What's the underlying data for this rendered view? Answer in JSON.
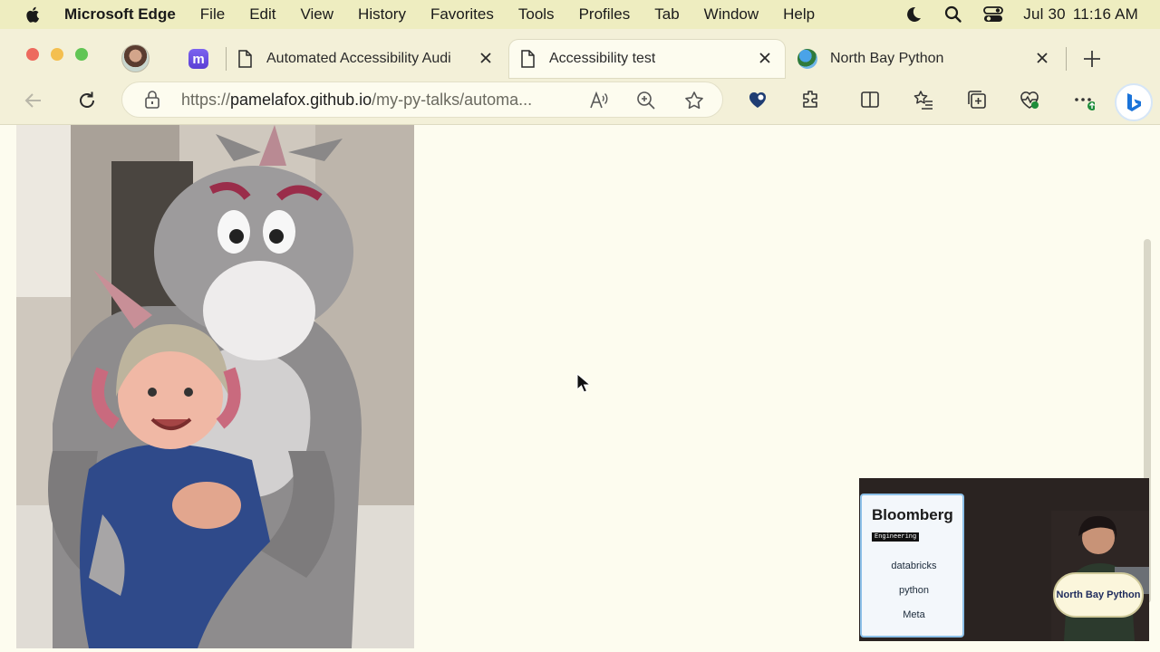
{
  "menubar": {
    "app_name": "Microsoft Edge",
    "items": [
      "File",
      "Edit",
      "View",
      "History",
      "Favorites",
      "Tools",
      "Profiles",
      "Tab",
      "Window",
      "Help"
    ],
    "date": "Jul 30",
    "time": "11:16 AM"
  },
  "tabs": [
    {
      "title": "Automated Accessibility Audi",
      "icon": "document-icon",
      "active": false
    },
    {
      "title": "Accessibility test",
      "icon": "document-icon",
      "active": true
    },
    {
      "title": "North Bay Python",
      "icon": "globe-icon",
      "active": false
    }
  ],
  "address_bar": {
    "url_prefix": "https://",
    "url_host": "pamelafox.github.io",
    "url_path": "/my-py-talks/automa..."
  },
  "page": {
    "image_description_icon": "photo"
  },
  "video_overlay": {
    "sponsor_main": "Bloomberg",
    "sponsor_sub": "Engineering",
    "sponsors": [
      "databricks",
      "python",
      "Meta"
    ],
    "event_sign": "North Bay Python"
  },
  "colors": {
    "menubar_bg": "#eeedc0",
    "chrome_bg": "#f3f0d8",
    "page_bg": "#fdfcef",
    "close_red": "#ed6a5e",
    "minimize_yellow": "#f4bf4f",
    "zoom_green": "#61c554"
  }
}
